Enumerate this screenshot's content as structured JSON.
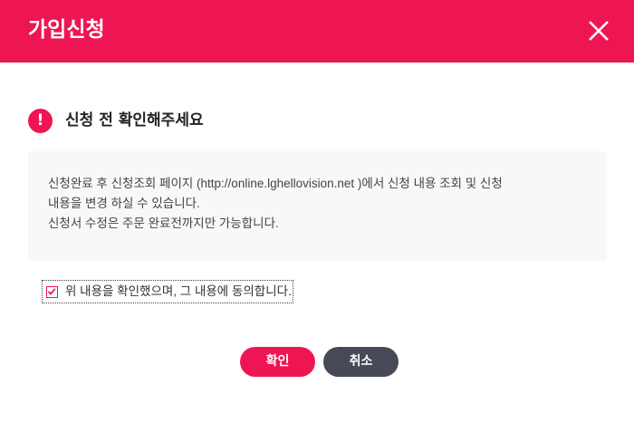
{
  "dialog": {
    "title": "가입신청",
    "close_icon": "close-icon"
  },
  "notice": {
    "icon_symbol": "!",
    "title": "신청 전 확인해주세요"
  },
  "info": {
    "lines": [
      "신청완료 후 신청조회 페이지 (http://online.lghellovision.net )에서 신청 내용 조회 및 신청",
      "내용을 변경 하실 수 있습니다.",
      "신청서 수정은 주문 완료전까지만 가능합니다."
    ]
  },
  "agreement": {
    "checked": true,
    "label": "위 내용을 확인했으며, 그 내용에 동의합니다."
  },
  "buttons": {
    "confirm_label": "확인",
    "cancel_label": "취소"
  },
  "colors": {
    "accent": "#ee1652",
    "cancel": "#474a56",
    "info_bg": "#f8f8f8"
  }
}
